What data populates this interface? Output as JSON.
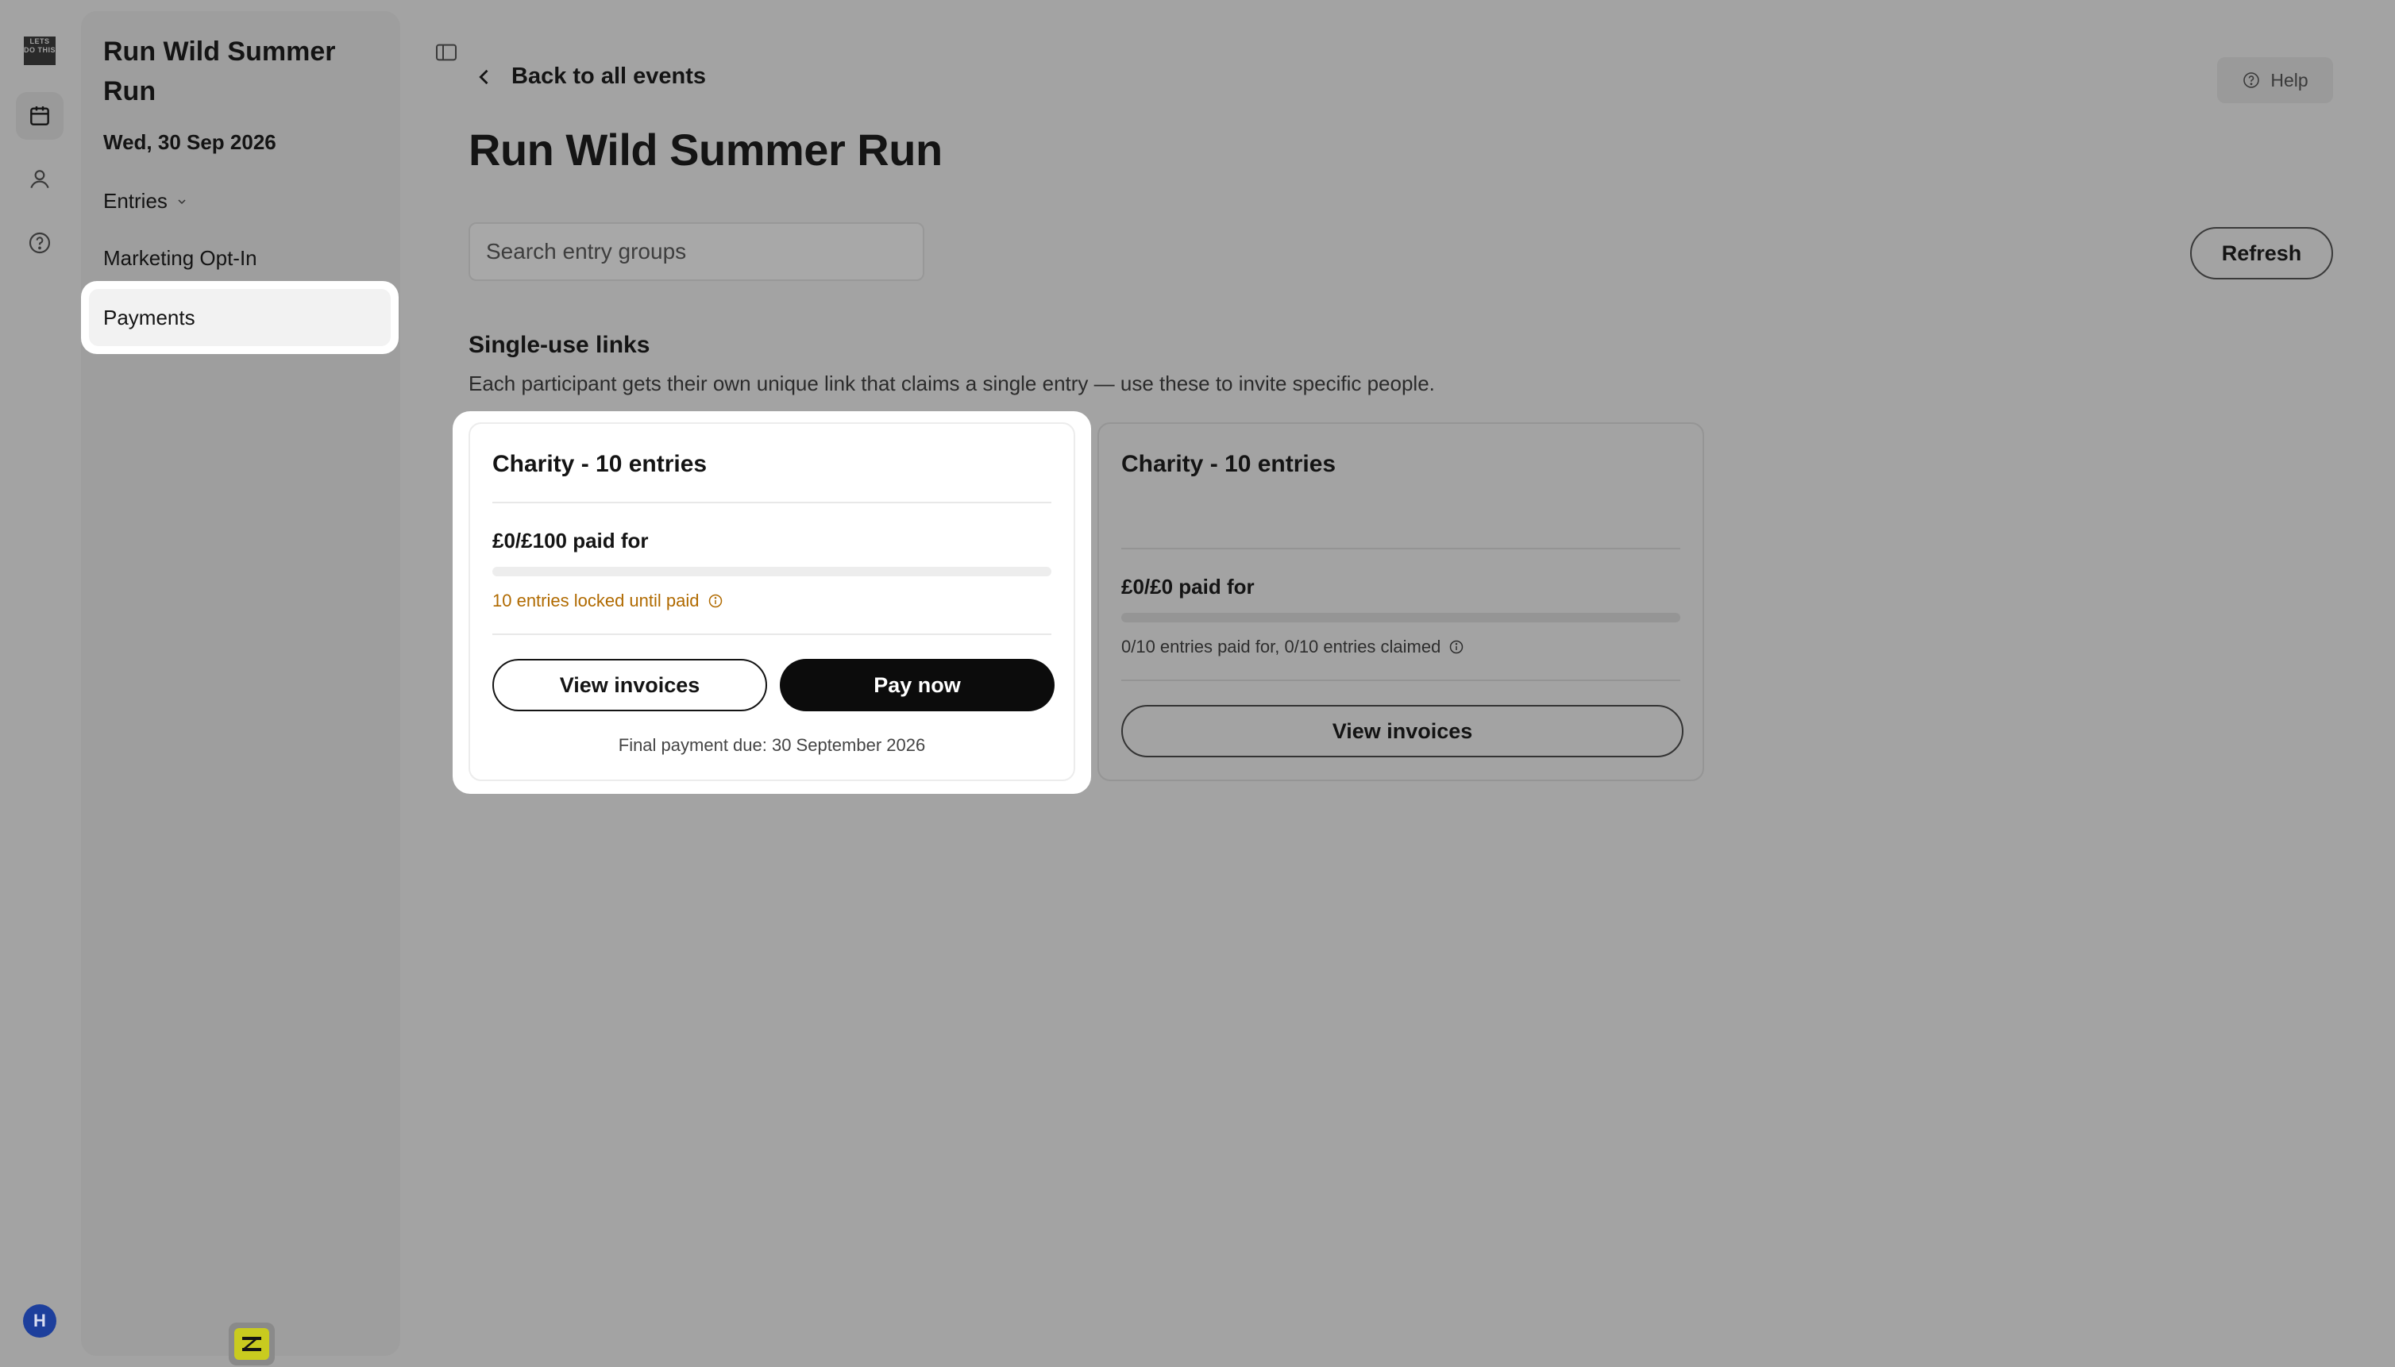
{
  "rail": {
    "logo_text": "LETS DO THIS",
    "avatar_initial": "H"
  },
  "sidebar": {
    "event_title": "Run Wild Summer Run",
    "event_date": "Wed, 30 Sep 2026",
    "nav": {
      "entries": "Entries",
      "marketing": "Marketing Opt-In",
      "payments": "Payments"
    }
  },
  "main": {
    "back_label": "Back to all events",
    "help_label": "Help",
    "title": "Run Wild Summer Run",
    "search_placeholder": "Search entry groups",
    "refresh_label": "Refresh",
    "section": {
      "title": "Single-use links",
      "description": "Each participant gets their own unique link that claims a single entry — use these to invite specific people."
    },
    "cards": [
      {
        "title": "Charity - 10 entries",
        "paid_for": "£0/£100 paid for",
        "progress": 0,
        "note": "10 entries locked until paid",
        "view_invoices": "View invoices",
        "pay_now": "Pay now",
        "due": "Final payment due: 30 September 2026"
      },
      {
        "title": "Charity - 10 entries",
        "paid_for": "£0/£0 paid for",
        "progress": 0,
        "note": "0/10 entries paid for, 0/10 entries claimed",
        "view_invoices": "View invoices"
      }
    ]
  },
  "colors": {
    "overlay": "#a3a3a3",
    "highlight": "#ffffff",
    "primary_button": "#0c0c0c",
    "warning_text": "#b06a00",
    "avatar": "#1d3f9c",
    "badge": "#c9cb1f"
  }
}
